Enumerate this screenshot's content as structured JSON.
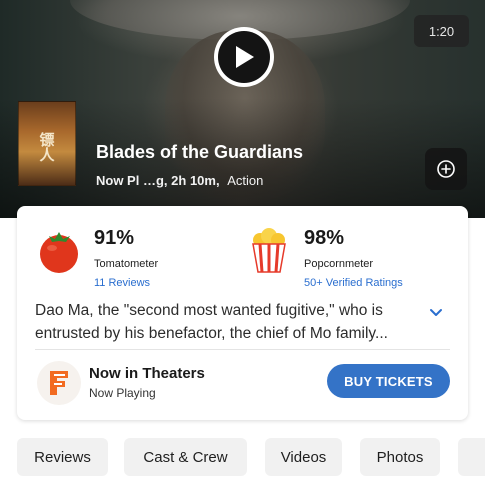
{
  "hero": {
    "duration": "1:20",
    "poster_text": "镖人",
    "title": "Blades of the Guardians",
    "status": "Now Pl",
    "status_obscured": "…g,",
    "runtime": "2h 10m,",
    "genre": "Action"
  },
  "scores": {
    "tomatometer": {
      "value": "91%",
      "label": "Tomatometer",
      "link": "11 Reviews"
    },
    "popcornmeter": {
      "value": "98%",
      "label": "Popcornmeter",
      "link": "50+ Verified Ratings"
    }
  },
  "synopsis": "Dao Ma, the \"second most wanted fugitive,\" who is entrusted by his benefactor, the chief of Mo family...",
  "theaters": {
    "title": "Now in Theaters",
    "subtitle": "Now Playing",
    "button_label": "BUY TICKETS"
  },
  "tabs": [
    "Reviews",
    "Cast & Crew",
    "Videos",
    "Photos",
    ""
  ],
  "icons": {
    "play": "play-icon",
    "add": "add-circle-icon",
    "tomato": "tomato-icon",
    "popcorn": "popcorn-icon",
    "expand": "chevron-down-icon",
    "fandango": "fandango-icon"
  },
  "colors": {
    "accent": "#3473c7",
    "link": "#2a6ecf",
    "tomato": "#e0361c",
    "popcorn_stripe": "#e63a2a"
  }
}
